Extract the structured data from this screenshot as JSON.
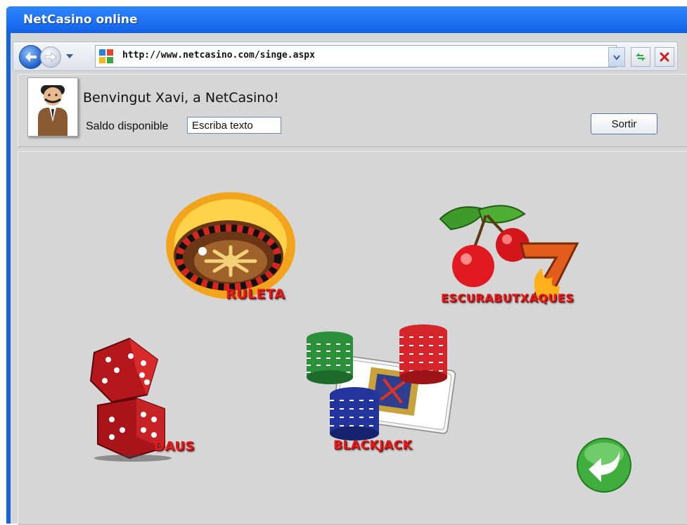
{
  "window": {
    "title": "NetCasino online"
  },
  "browser": {
    "url": "http://www.netcasino.com/singe.aspx",
    "icons": {
      "back": "back-arrow-icon",
      "forward": "forward-arrow-icon",
      "dropdown": "chevron-down-icon",
      "refresh": "refresh-icon",
      "stop": "close-icon"
    }
  },
  "header": {
    "welcome": "Benvingut Xavi, a NetCasino!",
    "balance_label": "Saldo disponible",
    "balance_value": "Escriba texto",
    "logout_label": "Sortir"
  },
  "games": [
    {
      "label": "RULETA",
      "icon": "roulette-icon"
    },
    {
      "label": "ESCURABUTXAQUES",
      "icon": "slot-machine-icon"
    },
    {
      "label": "DAUS",
      "icon": "dice-icon"
    },
    {
      "label": "BLACKJACK",
      "icon": "cards-chips-icon"
    }
  ],
  "colors": {
    "title_bar": "#1565e0",
    "panel": "#d6d6d6",
    "game_label": "#e31b1b",
    "back_button": "#3fae3c"
  }
}
